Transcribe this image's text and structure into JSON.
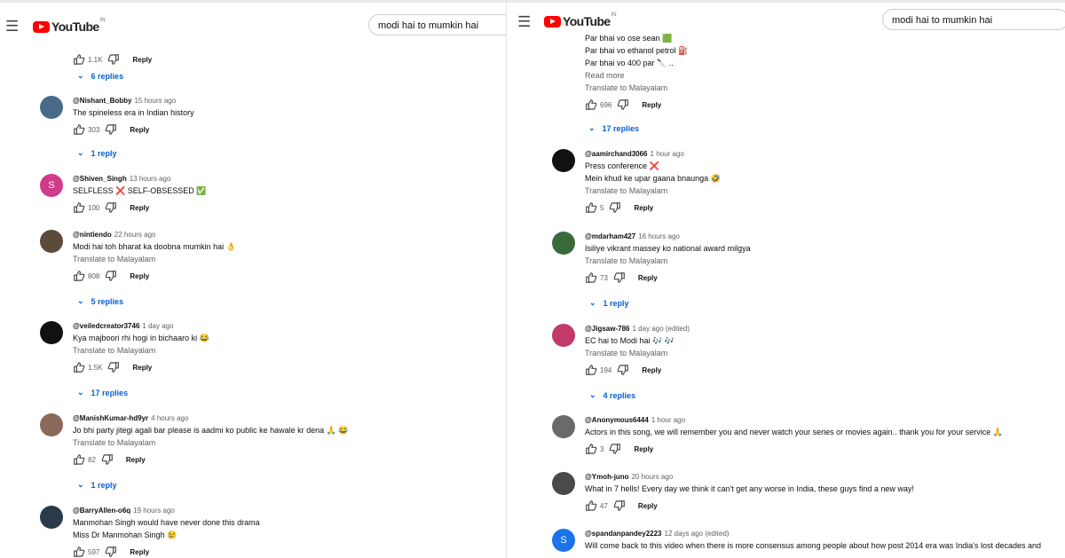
{
  "left": {
    "brand": "YouTube",
    "brand_sup": "IN",
    "search_value": "modi hai to mumkin hai",
    "top_actions": {
      "likes": "1.1K",
      "reply": "Reply"
    },
    "top_replies": "6 replies",
    "comments": [
      {
        "handle": "@Nishant_Bobby",
        "time": "15 hours ago",
        "lines": [
          "The spineless era in Indian history"
        ],
        "translate": "",
        "likes": "303",
        "reply": "Reply",
        "replies": "1 reply",
        "avatar_letter": "",
        "avatar_color": "#4a6a8a"
      },
      {
        "handle": "@Shiven_Singh",
        "time": "13 hours ago",
        "lines": [
          "SELFLESS ❌  SELF-OBSESSED ✅"
        ],
        "translate": "",
        "likes": "100",
        "reply": "Reply",
        "replies": "",
        "avatar_letter": "S",
        "avatar_color": "#d23a8a"
      },
      {
        "handle": "@nintiendo",
        "time": "22 hours ago",
        "lines": [
          "Modi hai toh bharat ka doobna mumkin hai 👌"
        ],
        "translate": "Translate to Malayalam",
        "likes": "808",
        "reply": "Reply",
        "replies": "5 replies",
        "avatar_letter": "",
        "avatar_color": "#5c4a3a"
      },
      {
        "handle": "@veiledcreator3746",
        "time": "1 day ago",
        "lines": [
          "Kya majboori rhi hogi in bichaaro ki 😂"
        ],
        "translate": "Translate to Malayalam",
        "likes": "1.5K",
        "reply": "Reply",
        "replies": "17 replies",
        "avatar_letter": "",
        "avatar_color": "#111111"
      },
      {
        "handle": "@ManishKumar-hd9yr",
        "time": "4 hours ago",
        "lines": [
          "Jo bhi party jitegi agali bar please is aadmi ko public ke hawale kr dena 🙏 😂"
        ],
        "translate": "Translate to Malayalam",
        "likes": "82",
        "reply": "Reply",
        "replies": "1 reply",
        "avatar_letter": "",
        "avatar_color": "#8a6a5a"
      },
      {
        "handle": "@BarryAllen-o6q",
        "time": "19 hours ago",
        "lines": [
          "Manmohan Singh would have never done this drama",
          "Miss Dr Manmohan Singh 😢"
        ],
        "translate": "",
        "likes": "597",
        "reply": "Reply",
        "replies": "",
        "avatar_letter": "",
        "avatar_color": "#2a3a4a"
      }
    ]
  },
  "right": {
    "brand": "YouTube",
    "brand_sup": "IN",
    "search_value": "modi hai to mumkin hai",
    "top_lines": [
      "Par bhai vo ose sean 🟩",
      "Par bhai vo ethanol petrol ⛽",
      "Par bhai vo 400 par 🔪 .."
    ],
    "top_read_more": "Read more",
    "top_translate": "Translate to Malayalam",
    "top_actions": {
      "likes": "696",
      "reply": "Reply"
    },
    "top_replies": "17 replies",
    "comments": [
      {
        "handle": "@aamirchand3066",
        "time": "1 hour ago",
        "lines": [
          "Press conference ❌",
          "Mein khud ke upar gaana bnaunga 🤣"
        ],
        "translate": "Translate to Malayalam",
        "likes": "5",
        "reply": "Reply",
        "replies": "",
        "avatar_letter": "",
        "avatar_color": "#111111"
      },
      {
        "handle": "@mdarham427",
        "time": "16 hours ago",
        "lines": [
          "Isiliye vikrant massey ko national award milgya"
        ],
        "translate": "Translate to Malayalam",
        "likes": "73",
        "reply": "Reply",
        "replies": "1 reply",
        "avatar_letter": "",
        "avatar_color": "#3a6a3a"
      },
      {
        "handle": "@Jigsaw-786",
        "time": "1 day ago (edited)",
        "lines": [
          "EC hai to Modi hai 🎶 🎶"
        ],
        "translate": "Translate to Malayalam",
        "likes": "194",
        "reply": "Reply",
        "replies": "4 replies",
        "avatar_letter": "",
        "avatar_color": "#c23a6a"
      },
      {
        "handle": "@Anonymous6444",
        "time": "1 hour ago",
        "lines": [
          "Actors in this song, we will remember you and never watch your series or movies again.. thank you for your service 🙏"
        ],
        "translate": "",
        "likes": "3",
        "reply": "Reply",
        "replies": "",
        "avatar_letter": "",
        "avatar_color": "#6a6a6a"
      },
      {
        "handle": "@Ymoh-juno",
        "time": "20 hours ago",
        "lines": [
          "What in 7 hells! Every day we think it can't get any worse in India, these guys find a new way!"
        ],
        "translate": "",
        "likes": "47",
        "reply": "Reply",
        "replies": "",
        "avatar_letter": "",
        "avatar_color": "#4a4a4a"
      },
      {
        "handle": "@spandanpandey2223",
        "time": "12 days ago (edited)",
        "lines": [
          "Will come back to this video when there is more consensus among people about how post 2014 era was India's lost decades and"
        ],
        "translate": "",
        "likes": "",
        "reply": "",
        "replies": "",
        "avatar_letter": "S",
        "avatar_color": "#1a73e8"
      }
    ]
  }
}
